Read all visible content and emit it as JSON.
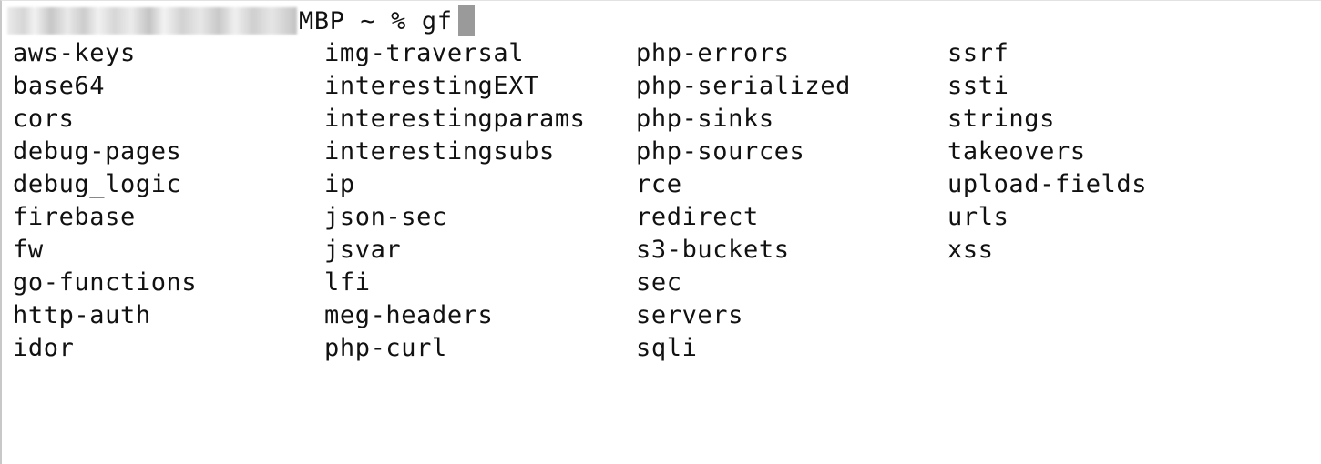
{
  "terminal": {
    "prompt": {
      "host_suffix": "MBP ~ % ",
      "command": "gf"
    },
    "columns": [
      [
        "aws-keys",
        "base64",
        "cors",
        "debug-pages",
        "debug_logic",
        "firebase",
        "fw",
        "go-functions",
        "http-auth",
        "idor"
      ],
      [
        "img-traversal",
        "interestingEXT",
        "interestingparams",
        "interestingsubs",
        "ip",
        "json-sec",
        "jsvar",
        "lfi",
        "meg-headers",
        "php-curl"
      ],
      [
        "php-errors",
        "php-serialized",
        "php-sinks",
        "php-sources",
        "rce",
        "redirect",
        "s3-buckets",
        "sec",
        "servers",
        "sqli"
      ],
      [
        "ssrf",
        "ssti",
        "strings",
        "takeovers",
        "upload-fields",
        "urls",
        "xss"
      ]
    ]
  },
  "colors": {
    "background": "#ffffff",
    "text": "#111111",
    "cursor": "#9a9a9a"
  }
}
